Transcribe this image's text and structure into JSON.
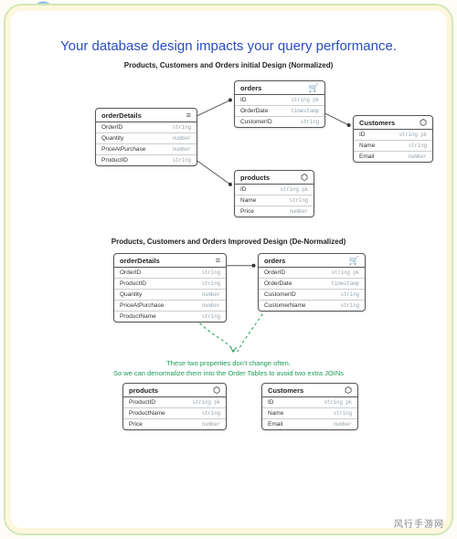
{
  "headline": "Your database design impacts your query performance.",
  "section1_title": "Products, Customers and Orders initial Design (Normalized)",
  "section2_title": "Products, Customers and Orders Improved Design (De-Normalized)",
  "note_line1": "These two properties don't change often.",
  "note_line2": "So we can denormalize them into the Order Tables to avoid two extra JOINs",
  "watermark": "风行手游网",
  "entities": {
    "orderDetails1": {
      "name": "orderDetails",
      "icon": "≡",
      "fields": [
        {
          "name": "OrderID",
          "type": "string"
        },
        {
          "name": "Quantity",
          "type": "number"
        },
        {
          "name": "PriceAtPurchase",
          "type": "number"
        },
        {
          "name": "ProductID",
          "type": "string"
        }
      ]
    },
    "orders1": {
      "name": "orders",
      "icon": "🛒",
      "fields": [
        {
          "name": "ID",
          "type": "string pk"
        },
        {
          "name": "OrderDate",
          "type": "timestamp"
        },
        {
          "name": "CustomerID",
          "type": "string"
        }
      ]
    },
    "customers1": {
      "name": "Customers",
      "icon": "⬡",
      "fields": [
        {
          "name": "ID",
          "type": "string pk"
        },
        {
          "name": "Name",
          "type": "string"
        },
        {
          "name": "Email",
          "type": "number"
        }
      ]
    },
    "products1": {
      "name": "products",
      "icon": "⬡",
      "fields": [
        {
          "name": "ID",
          "type": "string pk"
        },
        {
          "name": "Name",
          "type": "string"
        },
        {
          "name": "Price",
          "type": "number"
        }
      ]
    },
    "orderDetails2": {
      "name": "orderDetails",
      "icon": "≡",
      "fields": [
        {
          "name": "OrderID",
          "type": "string"
        },
        {
          "name": "ProductID",
          "type": "string"
        },
        {
          "name": "Quantity",
          "type": "number"
        },
        {
          "name": "PriceAtPurchase",
          "type": "number"
        },
        {
          "name": "ProductName",
          "type": "string"
        }
      ]
    },
    "orders2": {
      "name": "orders",
      "icon": "🛒",
      "fields": [
        {
          "name": "OrderID",
          "type": "string pk"
        },
        {
          "name": "OrderDate",
          "type": "timestamp"
        },
        {
          "name": "CustomerID",
          "type": "string"
        },
        {
          "name": "CustomerName",
          "type": "string"
        }
      ]
    },
    "products2": {
      "name": "products",
      "icon": "⬡",
      "fields": [
        {
          "name": "ProductID",
          "type": "string pk"
        },
        {
          "name": "ProductName",
          "type": "string"
        },
        {
          "name": "Price",
          "type": "number"
        }
      ]
    },
    "customers2": {
      "name": "Customers",
      "icon": "⬡",
      "fields": [
        {
          "name": "ID",
          "type": "string pk"
        },
        {
          "name": "Name",
          "type": "string"
        },
        {
          "name": "Email",
          "type": "number"
        }
      ]
    }
  }
}
